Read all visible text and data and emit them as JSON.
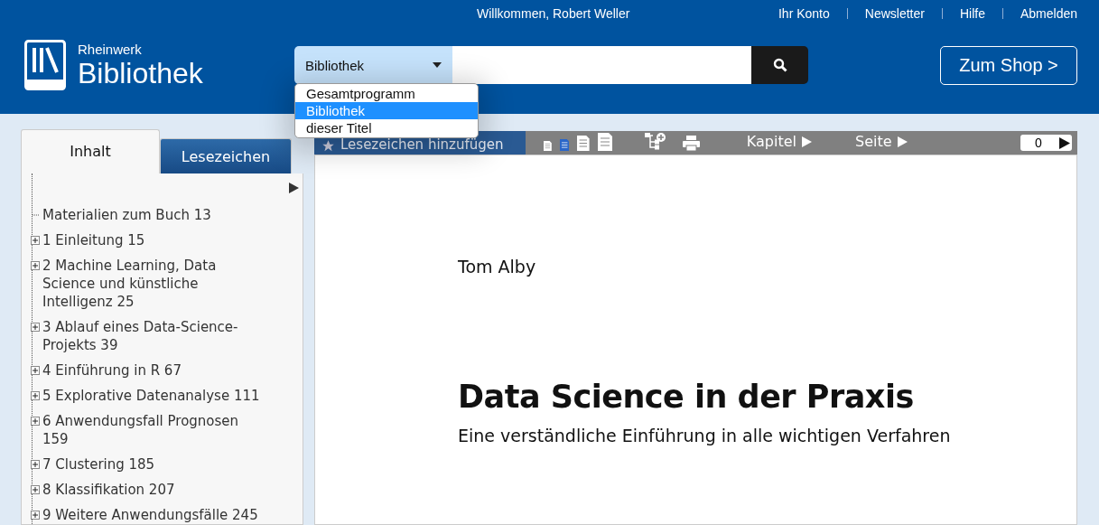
{
  "top_bar": {
    "welcome": "Willkommen, Robert Weller",
    "links": [
      "Ihr Konto",
      "Newsletter",
      "Hilfe",
      "Abmelden"
    ]
  },
  "logo": {
    "small": "Rheinwerk",
    "large": "Bibliothek"
  },
  "search": {
    "scope": "Bibliothek",
    "options": [
      {
        "label": "Gesamtprogramm",
        "selected": false
      },
      {
        "label": "Bibliothek",
        "selected": true
      },
      {
        "label": "dieser Titel",
        "selected": false
      }
    ]
  },
  "shop_button": "Zum Shop >",
  "sidebar": {
    "tabs": [
      {
        "label": "Inhalt",
        "selected": true
      },
      {
        "label": "Lesezeichen",
        "selected": false
      }
    ],
    "items": [
      {
        "kind": "leaf",
        "label": "Materialien zum Buch 13"
      },
      {
        "kind": "node",
        "expanded": false,
        "label": "1 Einleitung 15"
      },
      {
        "kind": "node",
        "expanded": false,
        "label": "2 Machine Learning, Data Science und künstliche Intelligenz 25"
      },
      {
        "kind": "node",
        "expanded": false,
        "label": "3 Ablauf eines Data-Science-Projekts 39"
      },
      {
        "kind": "node",
        "expanded": false,
        "label": "4 Einführung in R 67"
      },
      {
        "kind": "node",
        "expanded": false,
        "label": "5 Explorative Datenanalyse 111"
      },
      {
        "kind": "node",
        "expanded": false,
        "label": "6 Anwendungsfall Prognosen 159"
      },
      {
        "kind": "node",
        "expanded": false,
        "label": "7 Clustering 185"
      },
      {
        "kind": "node",
        "expanded": false,
        "label": "8 Klassifikation 207"
      },
      {
        "kind": "node",
        "expanded": false,
        "label": "9 Weitere Anwendungsfälle 245"
      }
    ]
  },
  "toolbar": {
    "bookmark_button": "Lesezeichen hinzufügen",
    "view_sizes": [
      {
        "selected": false
      },
      {
        "selected": true
      },
      {
        "selected": false
      },
      {
        "selected": false
      }
    ],
    "chapter": "Kapitel",
    "page": "Seite",
    "page_field": "0"
  },
  "document": {
    "author": "Tom Alby",
    "title": "Data Science in der Praxis",
    "subtitle": "Eine verständliche Einführung in alle wichtigen Verfahren"
  }
}
